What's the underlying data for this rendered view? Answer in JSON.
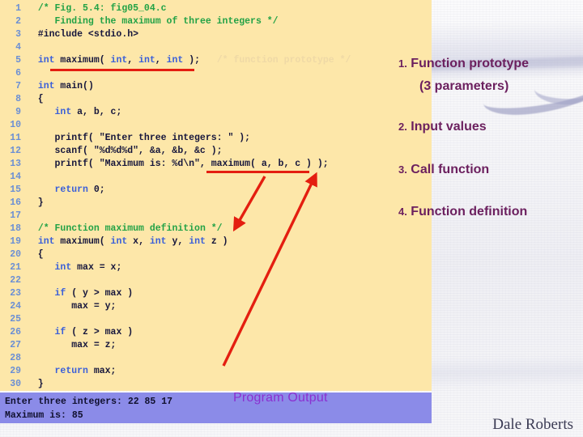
{
  "slide": {
    "title_comment": "Fig. 5.4: fig05_04.c",
    "author": "Dale Roberts"
  },
  "code": {
    "lines": [
      {
        "n": "1",
        "segments": [
          {
            "t": "  ",
            "c": "plain"
          },
          {
            "t": "/* Fig. 5.4: fig05_04.c",
            "c": "cmt"
          }
        ]
      },
      {
        "n": "2",
        "segments": [
          {
            "t": "     ",
            "c": "plain"
          },
          {
            "t": "Finding the maximum of three integers */",
            "c": "cmt"
          }
        ]
      },
      {
        "n": "3",
        "segments": [
          {
            "t": "  #include <stdio.h>",
            "c": "plain"
          }
        ]
      },
      {
        "n": "4",
        "segments": [
          {
            "t": "",
            "c": "plain"
          }
        ]
      },
      {
        "n": "5",
        "segments": [
          {
            "t": "  ",
            "c": "plain"
          },
          {
            "t": "int",
            "c": "kw"
          },
          {
            "t": " maximum( ",
            "c": "plain"
          },
          {
            "t": "int",
            "c": "kw"
          },
          {
            "t": ", ",
            "c": "plain"
          },
          {
            "t": "int",
            "c": "kw"
          },
          {
            "t": ", ",
            "c": "plain"
          },
          {
            "t": "int",
            "c": "kw"
          },
          {
            "t": " );   ",
            "c": "plain"
          },
          {
            "t": "/* function prototype */",
            "c": "cmt-faded"
          }
        ]
      },
      {
        "n": "6",
        "segments": [
          {
            "t": "",
            "c": "plain"
          }
        ]
      },
      {
        "n": "7",
        "segments": [
          {
            "t": "  ",
            "c": "plain"
          },
          {
            "t": "int",
            "c": "kw"
          },
          {
            "t": " main()",
            "c": "plain"
          }
        ]
      },
      {
        "n": "8",
        "segments": [
          {
            "t": "  {",
            "c": "plain"
          }
        ]
      },
      {
        "n": "9",
        "segments": [
          {
            "t": "     ",
            "c": "plain"
          },
          {
            "t": "int",
            "c": "kw"
          },
          {
            "t": " a, b, c;",
            "c": "plain"
          }
        ]
      },
      {
        "n": "10",
        "segments": [
          {
            "t": "",
            "c": "plain"
          }
        ]
      },
      {
        "n": "11",
        "segments": [
          {
            "t": "     printf( \"Enter three integers: \" );",
            "c": "plain"
          }
        ]
      },
      {
        "n": "12",
        "segments": [
          {
            "t": "     scanf( \"%d%d%d\", &a, &b, &c );",
            "c": "plain"
          }
        ]
      },
      {
        "n": "13",
        "segments": [
          {
            "t": "     printf( \"Maximum is: %d\\n\", maximum( a, b, c ) );",
            "c": "plain"
          }
        ]
      },
      {
        "n": "14",
        "segments": [
          {
            "t": "",
            "c": "plain"
          }
        ]
      },
      {
        "n": "15",
        "segments": [
          {
            "t": "     ",
            "c": "plain"
          },
          {
            "t": "return",
            "c": "kw"
          },
          {
            "t": " 0;",
            "c": "plain"
          }
        ]
      },
      {
        "n": "16",
        "segments": [
          {
            "t": "  }",
            "c": "plain"
          }
        ]
      },
      {
        "n": "17",
        "segments": [
          {
            "t": "",
            "c": "plain"
          }
        ]
      },
      {
        "n": "18",
        "segments": [
          {
            "t": "  ",
            "c": "plain"
          },
          {
            "t": "/* Function maximum definition */",
            "c": "cmt"
          }
        ]
      },
      {
        "n": "19",
        "segments": [
          {
            "t": "  ",
            "c": "plain"
          },
          {
            "t": "int",
            "c": "kw"
          },
          {
            "t": " maximum( ",
            "c": "plain"
          },
          {
            "t": "int",
            "c": "kw"
          },
          {
            "t": " x, ",
            "c": "plain"
          },
          {
            "t": "int",
            "c": "kw"
          },
          {
            "t": " y, ",
            "c": "plain"
          },
          {
            "t": "int",
            "c": "kw"
          },
          {
            "t": " z )",
            "c": "plain"
          }
        ]
      },
      {
        "n": "20",
        "segments": [
          {
            "t": "  {",
            "c": "plain"
          }
        ]
      },
      {
        "n": "21",
        "segments": [
          {
            "t": "     ",
            "c": "plain"
          },
          {
            "t": "int",
            "c": "kw"
          },
          {
            "t": " max = x;",
            "c": "plain"
          }
        ]
      },
      {
        "n": "22",
        "segments": [
          {
            "t": "",
            "c": "plain"
          }
        ]
      },
      {
        "n": "23",
        "segments": [
          {
            "t": "     ",
            "c": "plain"
          },
          {
            "t": "if",
            "c": "kw"
          },
          {
            "t": " ( y > max )",
            "c": "plain"
          }
        ]
      },
      {
        "n": "24",
        "segments": [
          {
            "t": "        max = y;",
            "c": "plain"
          }
        ]
      },
      {
        "n": "25",
        "segments": [
          {
            "t": "",
            "c": "plain"
          }
        ]
      },
      {
        "n": "26",
        "segments": [
          {
            "t": "     ",
            "c": "plain"
          },
          {
            "t": "if",
            "c": "kw"
          },
          {
            "t": " ( z > max )",
            "c": "plain"
          }
        ]
      },
      {
        "n": "27",
        "segments": [
          {
            "t": "        max = z;",
            "c": "plain"
          }
        ]
      },
      {
        "n": "28",
        "segments": [
          {
            "t": "",
            "c": "plain"
          }
        ]
      },
      {
        "n": "29",
        "segments": [
          {
            "t": "     ",
            "c": "plain"
          },
          {
            "t": "return",
            "c": "kw"
          },
          {
            "t": " max;",
            "c": "plain"
          }
        ]
      },
      {
        "n": "30",
        "segments": [
          {
            "t": "  }",
            "c": "plain"
          }
        ]
      }
    ]
  },
  "output": {
    "label": "Program Output",
    "lines": [
      "Enter three integers: 22 85 17",
      "Maximum is: 85"
    ]
  },
  "annotations": [
    {
      "num": "1.",
      "text": "Function prototype"
    },
    {
      "num": "",
      "text": "(3 parameters)"
    },
    {
      "num": "2.",
      "text": " Input values"
    },
    {
      "num": "3.",
      "text": "Call function"
    },
    {
      "num": "4.",
      "text": "Function definition"
    }
  ],
  "colors": {
    "code_bg": "#fde7a9",
    "line_number": "#6b8fd4",
    "keyword": "#3a5fd9",
    "comment": "#22a246",
    "code_text": "#16163c",
    "highlight_red": "#e41e10",
    "output_bg": "#8b8be8",
    "output_label": "#8b2fd0",
    "annotation": "#6b1f5e",
    "footer": "#3b3b54"
  }
}
